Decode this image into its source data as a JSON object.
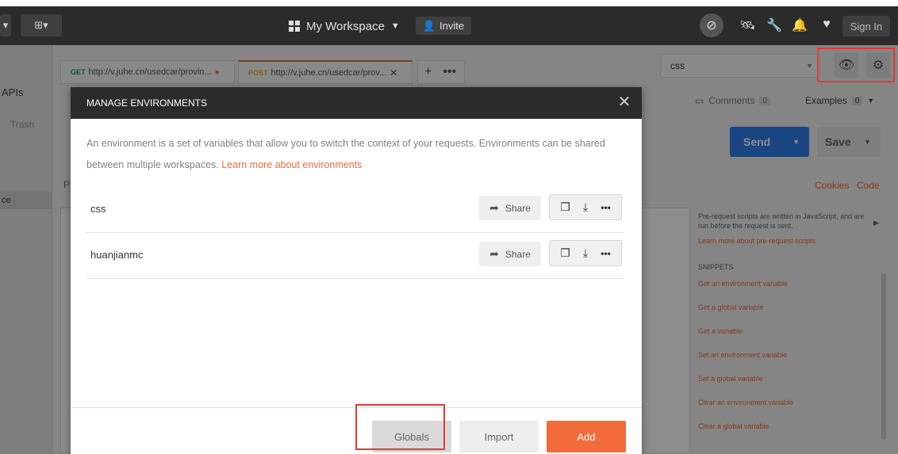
{
  "topbar": {
    "workspace_label": "My Workspace",
    "invite_label": "Invite",
    "signin_label": "Sign In"
  },
  "sidebar": {
    "apis_label": "APIs",
    "trash_label": "Trash",
    "workspace_fragment": "ce"
  },
  "tabs": [
    {
      "method": "GET",
      "url": "http://v.juhe.cn/usedcar/provin..."
    },
    {
      "method": "POST",
      "url": "http://v.juhe.cn/usedcar/prov..."
    }
  ],
  "environment_selector": {
    "value": "css"
  },
  "request": {
    "comments_label": "Comments",
    "comments_count": "0",
    "examples_label": "Examples",
    "examples_count": "0",
    "send_label": "Send",
    "save_label": "Save",
    "cookies_label": "Cookies",
    "code_label": "Code",
    "params_fragment": "P"
  },
  "scripts_panel": {
    "description": "Pre-request scripts are written in JavaScript, and are run before the request is sent.",
    "learn_more": "Learn more about pre-request scripts",
    "snippets_heading": "SNIPPETS",
    "snippets": [
      "Get an environment variable",
      "Get a global variable",
      "Get a variable",
      "Set an environment variable",
      "Set a global variable",
      "Clear an environment variable",
      "Clear a global variable"
    ]
  },
  "modal": {
    "title": "MANAGE ENVIRONMENTS",
    "description": "An environment is a set of variables that allow you to switch the context of your requests. Environments can be shared between multiple workspaces.",
    "learn_more_link": "Learn more about environments",
    "environments": [
      {
        "name": "css",
        "share_label": "Share"
      },
      {
        "name": "huanjianmc",
        "share_label": "Share"
      }
    ],
    "globals_label": "Globals",
    "import_label": "Import",
    "add_label": "Add"
  },
  "colors": {
    "accent": "#f26b3a",
    "send_blue": "#2f80ed",
    "highlight_red": "#e53935",
    "header_dark": "#2b2b2b"
  }
}
